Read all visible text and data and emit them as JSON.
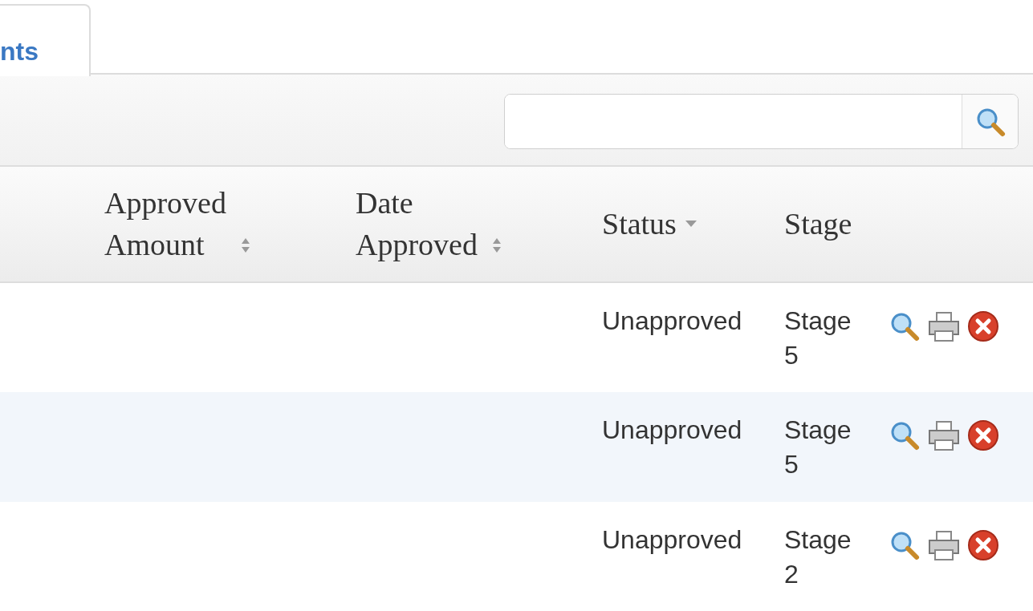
{
  "tabs": [
    {
      "label": "nts",
      "selected": true
    }
  ],
  "table": {
    "columns": [
      {
        "label": "Approved Amount",
        "sortable": true
      },
      {
        "label": "Date Approved",
        "sortable": true
      },
      {
        "label": "Status",
        "sortable": true,
        "sorted": true
      },
      {
        "label": "Stage",
        "sortable": false
      }
    ],
    "rows": [
      {
        "status": "Unapproved",
        "stage": "Stage 5"
      },
      {
        "status": "Unapproved",
        "stage": "Stage 5"
      },
      {
        "status": "Unapproved",
        "stage": "Stage 2"
      }
    ]
  }
}
